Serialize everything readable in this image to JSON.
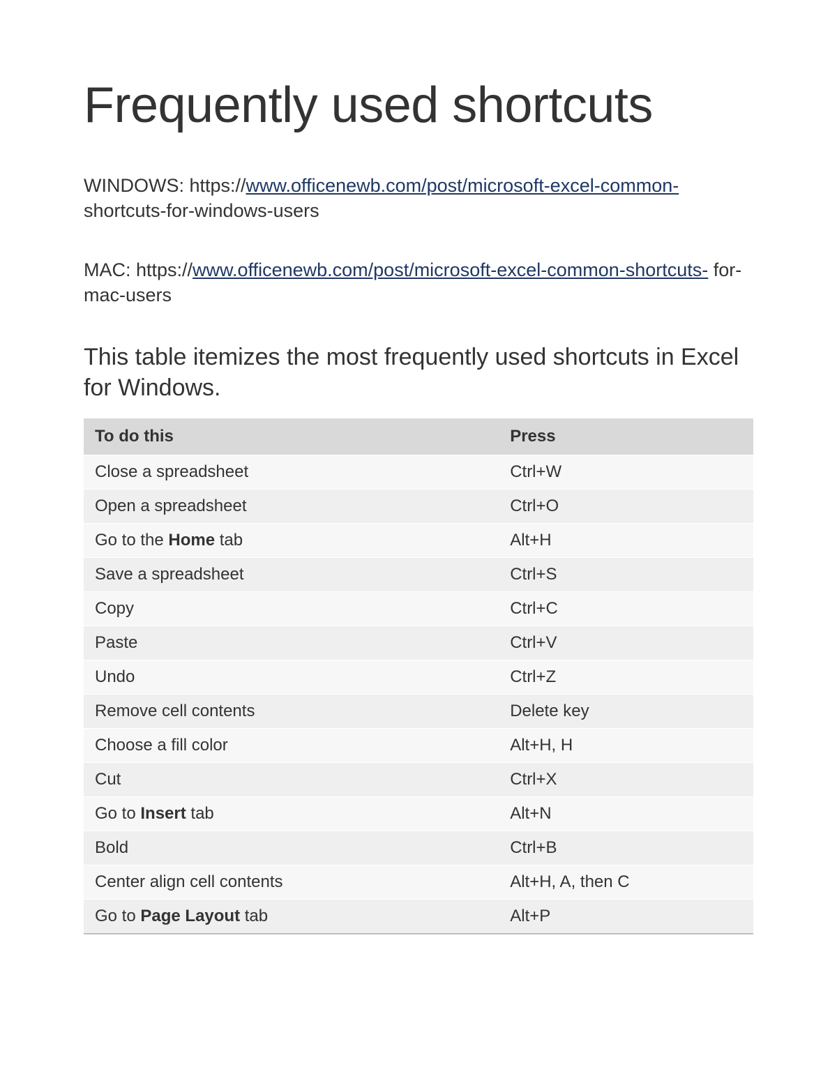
{
  "title": "Frequently used shortcuts",
  "sources": {
    "windows": {
      "prefix": "WINDOWS: https://",
      "link_text": "www.officenewb.com/post/microsoft-excel-common-",
      "suffix": " shortcuts-for-windows-users"
    },
    "mac": {
      "prefix": "MAC: https://",
      "link_text": "www.officenewb.com/post/microsoft-excel-common-shortcuts-",
      "suffix": " for-mac-users"
    }
  },
  "subheading": "This table itemizes the most frequently used shortcuts in Excel for Windows.",
  "table": {
    "headers": {
      "action": "To do this",
      "press": "Press"
    },
    "rows": [
      {
        "action_pre": "Close a spreadsheet",
        "action_bold": "",
        "action_post": "",
        "press": "Ctrl+W"
      },
      {
        "action_pre": "Open a spreadsheet",
        "action_bold": "",
        "action_post": "",
        "press": "Ctrl+O"
      },
      {
        "action_pre": "Go to the ",
        "action_bold": "Home",
        "action_post": " tab",
        "press": "Alt+H"
      },
      {
        "action_pre": "Save a spreadsheet",
        "action_bold": "",
        "action_post": "",
        "press": "Ctrl+S"
      },
      {
        "action_pre": "Copy",
        "action_bold": "",
        "action_post": "",
        "press": "Ctrl+C"
      },
      {
        "action_pre": "Paste",
        "action_bold": "",
        "action_post": "",
        "press": "Ctrl+V"
      },
      {
        "action_pre": "Undo",
        "action_bold": "",
        "action_post": "",
        "press": "Ctrl+Z"
      },
      {
        "action_pre": "Remove cell contents",
        "action_bold": "",
        "action_post": "",
        "press": "Delete key"
      },
      {
        "action_pre": "Choose a fill color",
        "action_bold": "",
        "action_post": "",
        "press": "Alt+H, H"
      },
      {
        "action_pre": "Cut",
        "action_bold": "",
        "action_post": "",
        "press": "Ctrl+X"
      },
      {
        "action_pre": "Go to ",
        "action_bold": "Insert",
        "action_post": " tab",
        "press": "Alt+N"
      },
      {
        "action_pre": "Bold",
        "action_bold": "",
        "action_post": "",
        "press": "Ctrl+B"
      },
      {
        "action_pre": "Center align cell contents",
        "action_bold": "",
        "action_post": "",
        "press": "Alt+H, A, then C"
      },
      {
        "action_pre": "Go to ",
        "action_bold": "Page Layout",
        "action_post": " tab",
        "press": "Alt+P"
      }
    ]
  }
}
